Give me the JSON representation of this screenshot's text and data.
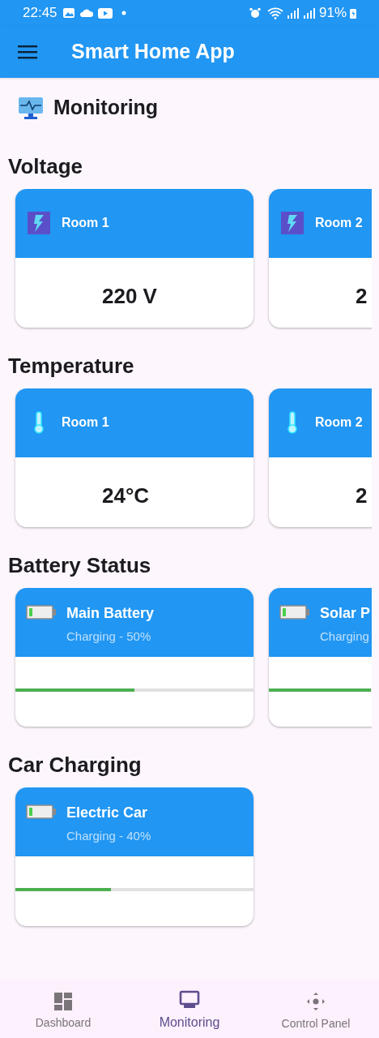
{
  "status_bar": {
    "time": "22:45",
    "battery_text": "91%"
  },
  "app_bar": {
    "title": "Smart Home App"
  },
  "page_title": "Monitoring",
  "sections": [
    {
      "title": "Voltage",
      "kind": "value",
      "cards": [
        {
          "name": "Room 1",
          "value": "220 V"
        },
        {
          "name": "Room 2",
          "value": "2"
        }
      ]
    },
    {
      "title": "Temperature",
      "kind": "temp",
      "cards": [
        {
          "name": "Room 1",
          "value": "24°C"
        },
        {
          "name": "Room 2",
          "value": "2"
        }
      ]
    },
    {
      "title": "Battery Status",
      "kind": "battery",
      "cards": [
        {
          "name": "Main Battery",
          "status": "Charging - 50%",
          "level": 0.5
        },
        {
          "name": "Solar P",
          "status": "Charging",
          "level": 0.43
        }
      ]
    },
    {
      "title": "Car Charging",
      "kind": "battery",
      "cards": [
        {
          "name": "Electric Car",
          "status": "Charging - 40%",
          "level": 0.4
        }
      ]
    }
  ],
  "nav": [
    {
      "label": "Dashboard",
      "selected": false
    },
    {
      "label": "Monitoring",
      "selected": true
    },
    {
      "label": "Control Panel",
      "selected": false
    }
  ]
}
